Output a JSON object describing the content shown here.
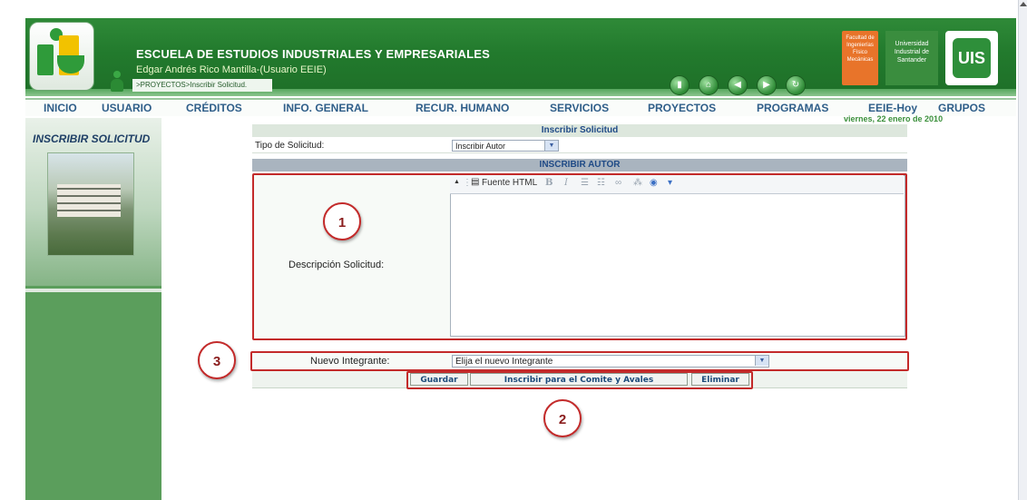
{
  "header": {
    "school_name": "ESCUELA DE ESTUDIOS INDUSTRIALES Y EMPRESARIALES",
    "user": "Edgar Andrés Rico Mantilla-(Usuario EEIE)",
    "breadcrumb": ">PROYECTOS>Inscribir Solicitud.",
    "facultad": "Facultad de Ingenierías Físico Mecánicas",
    "universidad": "Universidad Industrial de Santander",
    "uis": "UIS"
  },
  "menu": [
    "INICIO",
    "USUARIO",
    "CRÉDITOS",
    "INFO. GENERAL",
    "RECUR. HUMANO",
    "SERVICIOS",
    "PROYECTOS",
    "PROGRAMAS",
    "EEIE-Hoy",
    "GRUPOS"
  ],
  "date": "viernes, 22 enero de 2010",
  "sidebar": {
    "title": "INSCRIBIR SOLICITUD"
  },
  "form": {
    "header": "Inscribir Solicitud",
    "tipo_label": "Tipo de Solicitud:",
    "tipo_value": "Inscribir Autor",
    "section": "INSCRIBIR AUTOR",
    "descripcion_label": "Descripción Solicitud:",
    "editor_toolbar": {
      "source": "Fuente HTML",
      "bold": "B",
      "italic": "I"
    },
    "nuevo_label": "Nuevo Integrante:",
    "nuevo_value": "Elija el nuevo Integrante",
    "buttons": {
      "guardar": "Guardar",
      "inscribir": "Inscribir para el Comite y Avales",
      "eliminar": "Eliminar"
    }
  },
  "annotations": [
    "1",
    "2",
    "3"
  ]
}
